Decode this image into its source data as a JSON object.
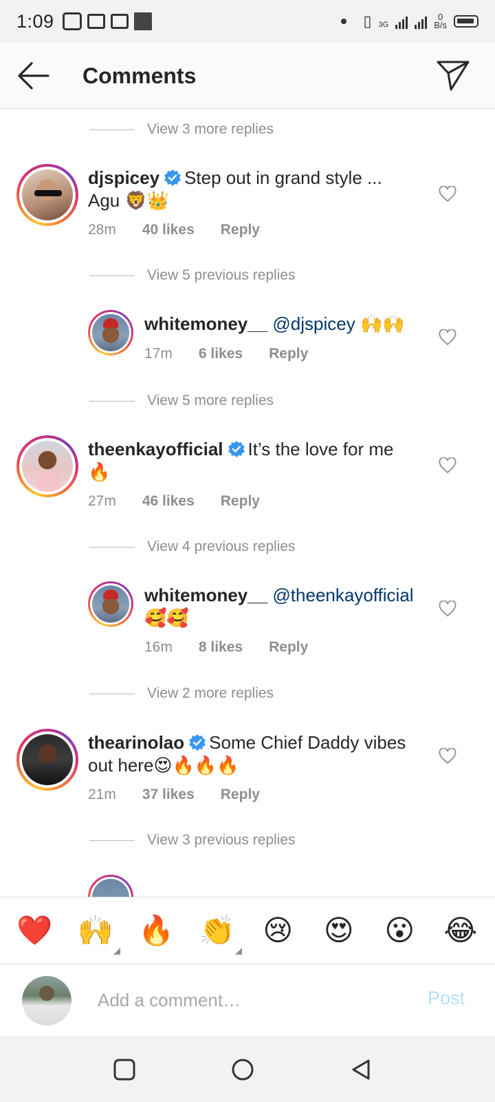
{
  "status_bar": {
    "time": "1:09",
    "network": "3G",
    "speed": "0",
    "speed_unit": "B/s"
  },
  "header": {
    "title": "Comments"
  },
  "comments": [
    {
      "view_replies": "View 3 more replies",
      "username": "djspicey",
      "verified": true,
      "text": "Step out in grand style ... Agu 🦁👑",
      "time": "28m",
      "likes": "40 likes",
      "reply_label": "Reply"
    },
    {
      "view_replies": "View 5 previous replies",
      "username": "whitemoney__",
      "verified": false,
      "mention": "@djspicey",
      "text": "🙌🙌",
      "time": "17m",
      "likes": "6 likes",
      "reply_label": "Reply"
    },
    {
      "view_replies": "View 5 more replies",
      "username": "theenkayofficial",
      "verified": true,
      "text": "It’s the love for me 🔥",
      "time": "27m",
      "likes": "46 likes",
      "reply_label": "Reply"
    },
    {
      "view_replies": "View 4 previous replies",
      "username": "whitemoney__",
      "verified": false,
      "mention": "@theenkayofficial",
      "text": "🥰🥰",
      "time": "16m",
      "likes": "8 likes",
      "reply_label": "Reply"
    },
    {
      "view_replies": "View 2 more replies",
      "username": "thearinolao",
      "verified": true,
      "text": "Some Chief Daddy vibes out here😍🔥🔥🔥",
      "time": "21m",
      "likes": "37 likes",
      "reply_label": "Reply"
    }
  ],
  "trailing_view_replies": "View 3 previous replies",
  "emoji_bar": [
    "❤️",
    "🙌",
    "🔥",
    "👏",
    "😢",
    "😍",
    "😮",
    "😂"
  ],
  "comment_input": {
    "placeholder": "Add a comment…",
    "post_label": "Post"
  },
  "colors": {
    "accent_blue": "#0095f6",
    "post_disabled": "#b2dffc",
    "verified_blue": "#3897f0",
    "mention": "#00376b"
  }
}
